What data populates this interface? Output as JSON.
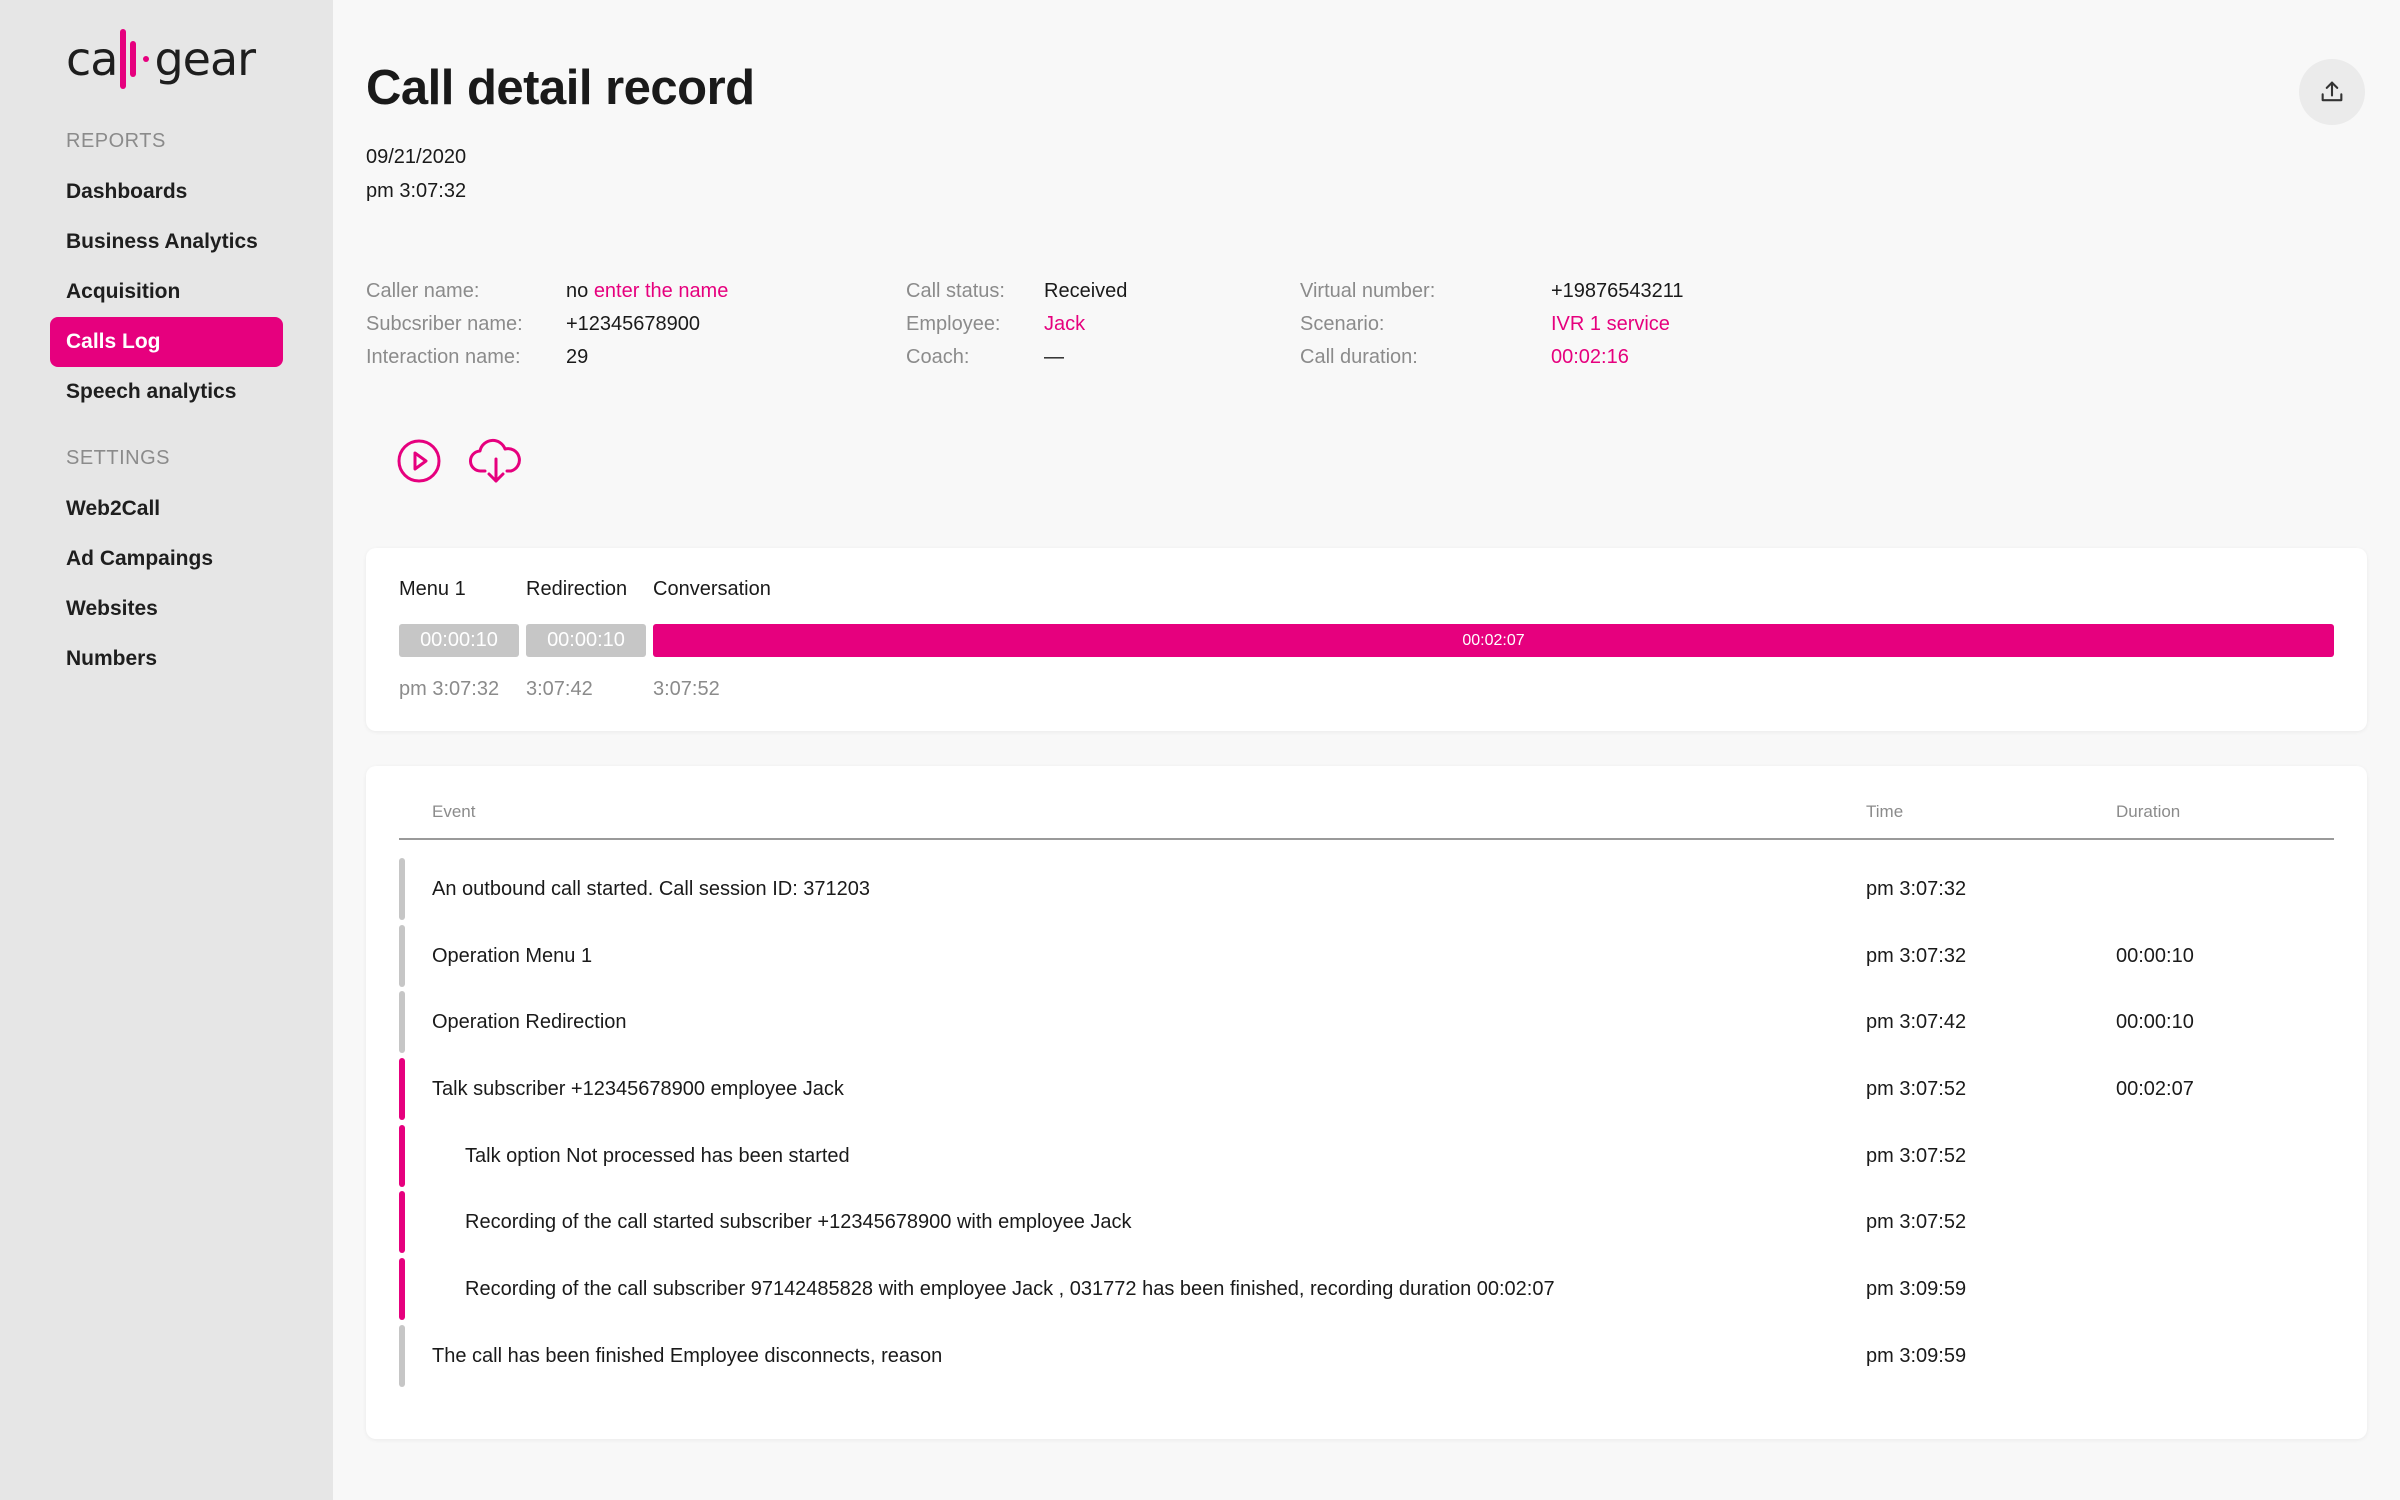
{
  "app": {
    "brand_left": "ca",
    "brand_right": "gear",
    "accent_color": "#e6007e"
  },
  "sidebar": {
    "reports_label": "REPORTS",
    "settings_label": "SETTINGS",
    "reports_items": [
      {
        "label": "Dashboards",
        "active": false
      },
      {
        "label": "Business Analytics",
        "active": false
      },
      {
        "label": "Acquisition",
        "active": false
      },
      {
        "label": "Calls Log",
        "active": true
      },
      {
        "label": "Speech analytics",
        "active": false
      }
    ],
    "settings_items": [
      {
        "label": "Web2Call"
      },
      {
        "label": "Ad Campaings"
      },
      {
        "label": "Websites"
      },
      {
        "label": "Numbers"
      }
    ]
  },
  "header": {
    "title": "Call detail record",
    "date": "09/21/2020",
    "time": "pm 3:07:32",
    "export_icon": "upload-icon"
  },
  "info": {
    "caller_name_label": "Caller name:",
    "caller_name_prefix": "no",
    "caller_name_link": "enter the name",
    "subscriber_name_label": "Subcsriber name:",
    "subscriber_name_value": "+12345678900",
    "interaction_name_label": "Interaction name:",
    "interaction_name_value": "29",
    "call_status_label": "Call status:",
    "call_status_value": "Received",
    "employee_label": "Employee:",
    "employee_value": "Jack",
    "coach_label": "Coach:",
    "coach_value": "—",
    "virtual_number_label": "Virtual number:",
    "virtual_number_value": "+19876543211",
    "scenario_label": "Scenario:",
    "scenario_value": "IVR 1 service",
    "call_duration_label": "Call duration:",
    "call_duration_value": "00:02:16"
  },
  "actions": {
    "play_icon": "play-circle-icon",
    "download_icon": "cloud-download-icon"
  },
  "timeline": {
    "segments": [
      {
        "label": "Menu 1",
        "duration": "00:00:10",
        "start": "pm 3:07:32",
        "color": "#c6c6c6"
      },
      {
        "label": "Redirection",
        "duration": "00:00:10",
        "start": "3:07:42",
        "color": "#c6c6c6"
      },
      {
        "label": "Conversation",
        "duration": "00:02:07",
        "start": "3:07:52",
        "color": "#e6007e"
      }
    ]
  },
  "events": {
    "headers": {
      "event": "Event",
      "time": "Time",
      "duration": "Duration"
    },
    "rows": [
      {
        "event": "An outbound call started. Call session ID: 371203",
        "time": "pm 3:07:32",
        "duration": "",
        "kind": "grey",
        "indent": false
      },
      {
        "event": "Operation Menu 1",
        "time": "pm 3:07:32",
        "duration": "00:00:10",
        "kind": "grey",
        "indent": false
      },
      {
        "event": "Operation Redirection",
        "time": "pm 3:07:42",
        "duration": "00:00:10",
        "kind": "grey",
        "indent": false
      },
      {
        "event": "Talk subscriber +12345678900 employee Jack",
        "time": "pm 3:07:52",
        "duration": "00:02:07",
        "kind": "talk",
        "indent": false
      },
      {
        "event": "Talk option Not processed has been started",
        "time": "pm 3:07:52",
        "duration": "",
        "kind": "talk",
        "indent": true
      },
      {
        "event": "Recording of the call started subscriber +12345678900 with employee Jack",
        "time": "pm 3:07:52",
        "duration": "",
        "kind": "talk",
        "indent": true
      },
      {
        "event": "Recording of the call subscriber 97142485828 with employee Jack , 031772 has been finished, recording duration 00:02:07",
        "time": "pm 3:09:59",
        "duration": "",
        "kind": "talk",
        "indent": true
      },
      {
        "event": "The call has been finished Employee disconnects, reason",
        "time": "pm 3:09:59",
        "duration": "",
        "kind": "grey",
        "indent": false
      }
    ]
  }
}
